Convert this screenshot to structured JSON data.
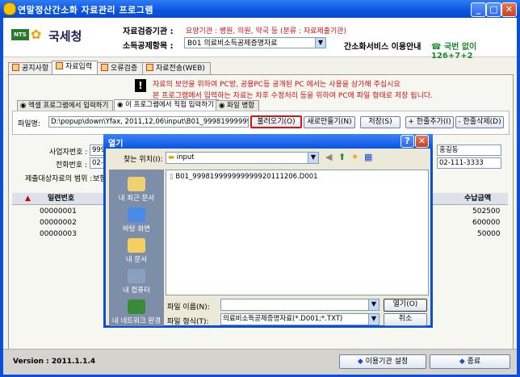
{
  "window": {
    "title": "연말정산간소화 자료관리 프로그램",
    "min": "_",
    "max": "□",
    "close": "✕"
  },
  "header": {
    "badge": "NTS",
    "agency": "국세청",
    "inst_label": "자료검증기관 :",
    "inst_value": "요양기관 : 병원, 의원, 약국 등 (분류 : 자료제출기관)",
    "deduct_label": "소득공제항목 :",
    "deduct_value": "B01 의료비소득공제증명자료",
    "service": "간소화서비스 이용안내",
    "phone": "☎ 국번 없이 126+7+2"
  },
  "tabs": [
    "공지사항",
    "자료입력",
    "오류검증",
    "자료전송(WEB)"
  ],
  "notice": {
    "line1": "자료의 보안을 위하여 PC방, 공용PC등 공개된 PC 에서는 사용을 삼가해 주십시요",
    "line2": "본 프로그램에서 입력하는 자료는 차후 수정처리 등을 위하여 PC에 파일 형태로 저장 됩니다."
  },
  "subtabs": [
    "엑셀 프로그램에서 입력하기",
    "이 프로그램에서 직접 입력하기",
    "파일 병합"
  ],
  "file": {
    "label": "파일명:",
    "path": "D:\\popup\\down\\Yfax, 2011,12,06\\input\\B01_99981999999999999"
  },
  "buttons": {
    "load": "불러오기(O)",
    "new": "새로만들기(N)",
    "save": "저장(S)",
    "add_row": "+ 한줄추가(I)",
    "del_row": "- 한줄삭제(D)"
  },
  "form": {
    "biz_label": "사업자번호 :",
    "biz_value": "999",
    "phone_label": "전화번호 :",
    "phone_value": "02-1",
    "range_label": "제출대상자료의 범위 :",
    "range_value": "보험",
    "name_value": "홍길동",
    "tel_value": "02-111-3333"
  },
  "grid": {
    "col_serial": "일련번호",
    "col_amount": "수납금액",
    "rows": [
      {
        "serial": "00000001",
        "amount": "502500"
      },
      {
        "serial": "00000002",
        "amount": "600000"
      },
      {
        "serial": "00000003",
        "amount": "50000"
      }
    ]
  },
  "status": {
    "version": "Version : 2011.1.1.4",
    "inst_btn": "이용기관 설정",
    "exit_btn": "종료"
  },
  "dialog": {
    "title": "열기",
    "help": "?",
    "close": "✕",
    "lookin_label": "찾는 위치(I):",
    "lookin_value": "input",
    "places": [
      "내 최근 문서",
      "바탕 화면",
      "내 문서",
      "내 컴퓨터",
      "내 네트워크 환경"
    ],
    "files": [
      "B01_999819999999999920111206.D001"
    ],
    "filename_label": "파일 이름(N):",
    "filename_value": "",
    "filetype_label": "파일 형식(T):",
    "filetype_value": "의료비소득공제증명자료(*.D001;*.TXT)",
    "open_btn": "열기(O)",
    "cancel_btn": "취소"
  }
}
